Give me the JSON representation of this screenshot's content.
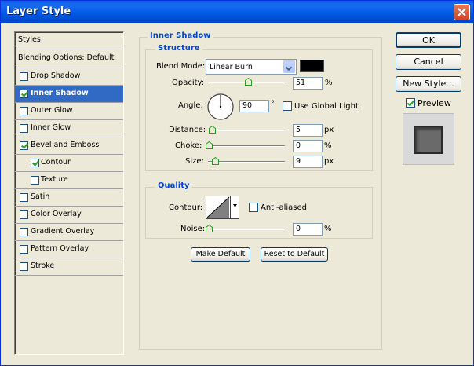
{
  "window": {
    "title": "Layer Style"
  },
  "styles_list": {
    "header": "Styles",
    "blending": "Blending Options: Default",
    "items": [
      {
        "label": "Drop Shadow",
        "checked": false,
        "selected": false,
        "sub": false
      },
      {
        "label": "Inner Shadow",
        "checked": true,
        "selected": true,
        "sub": false
      },
      {
        "label": "Outer Glow",
        "checked": false,
        "selected": false,
        "sub": false
      },
      {
        "label": "Inner Glow",
        "checked": false,
        "selected": false,
        "sub": false
      },
      {
        "label": "Bevel and Emboss",
        "checked": true,
        "selected": false,
        "sub": false
      },
      {
        "label": "Contour",
        "checked": true,
        "selected": false,
        "sub": true
      },
      {
        "label": "Texture",
        "checked": false,
        "selected": false,
        "sub": true
      },
      {
        "label": "Satin",
        "checked": false,
        "selected": false,
        "sub": false
      },
      {
        "label": "Color Overlay",
        "checked": false,
        "selected": false,
        "sub": false
      },
      {
        "label": "Gradient Overlay",
        "checked": false,
        "selected": false,
        "sub": false
      },
      {
        "label": "Pattern Overlay",
        "checked": false,
        "selected": false,
        "sub": false
      },
      {
        "label": "Stroke",
        "checked": false,
        "selected": false,
        "sub": false
      }
    ]
  },
  "inner_shadow": {
    "title": "Inner Shadow",
    "structure_title": "Structure",
    "blend_mode_label": "Blend Mode:",
    "blend_mode_value": "Linear Burn",
    "shadow_color": "#000000",
    "opacity_label": "Opacity:",
    "opacity_value": "51",
    "opacity_unit": "%",
    "angle_label": "Angle:",
    "angle_value": "90",
    "angle_unit": "°",
    "global_light_label": "Use Global Light",
    "global_light_checked": false,
    "distance_label": "Distance:",
    "distance_value": "5",
    "distance_unit": "px",
    "choke_label": "Choke:",
    "choke_value": "0",
    "choke_unit": "%",
    "size_label": "Size:",
    "size_value": "9",
    "size_unit": "px"
  },
  "quality": {
    "title": "Quality",
    "contour_label": "Contour:",
    "anti_aliased_label": "Anti-aliased",
    "anti_aliased_checked": false,
    "noise_label": "Noise:",
    "noise_value": "0",
    "noise_unit": "%"
  },
  "buttons": {
    "make_default": "Make Default",
    "reset_default": "Reset to Default",
    "ok": "OK",
    "cancel": "Cancel",
    "new_style": "New Style...",
    "preview_label": "Preview",
    "preview_checked": true
  }
}
